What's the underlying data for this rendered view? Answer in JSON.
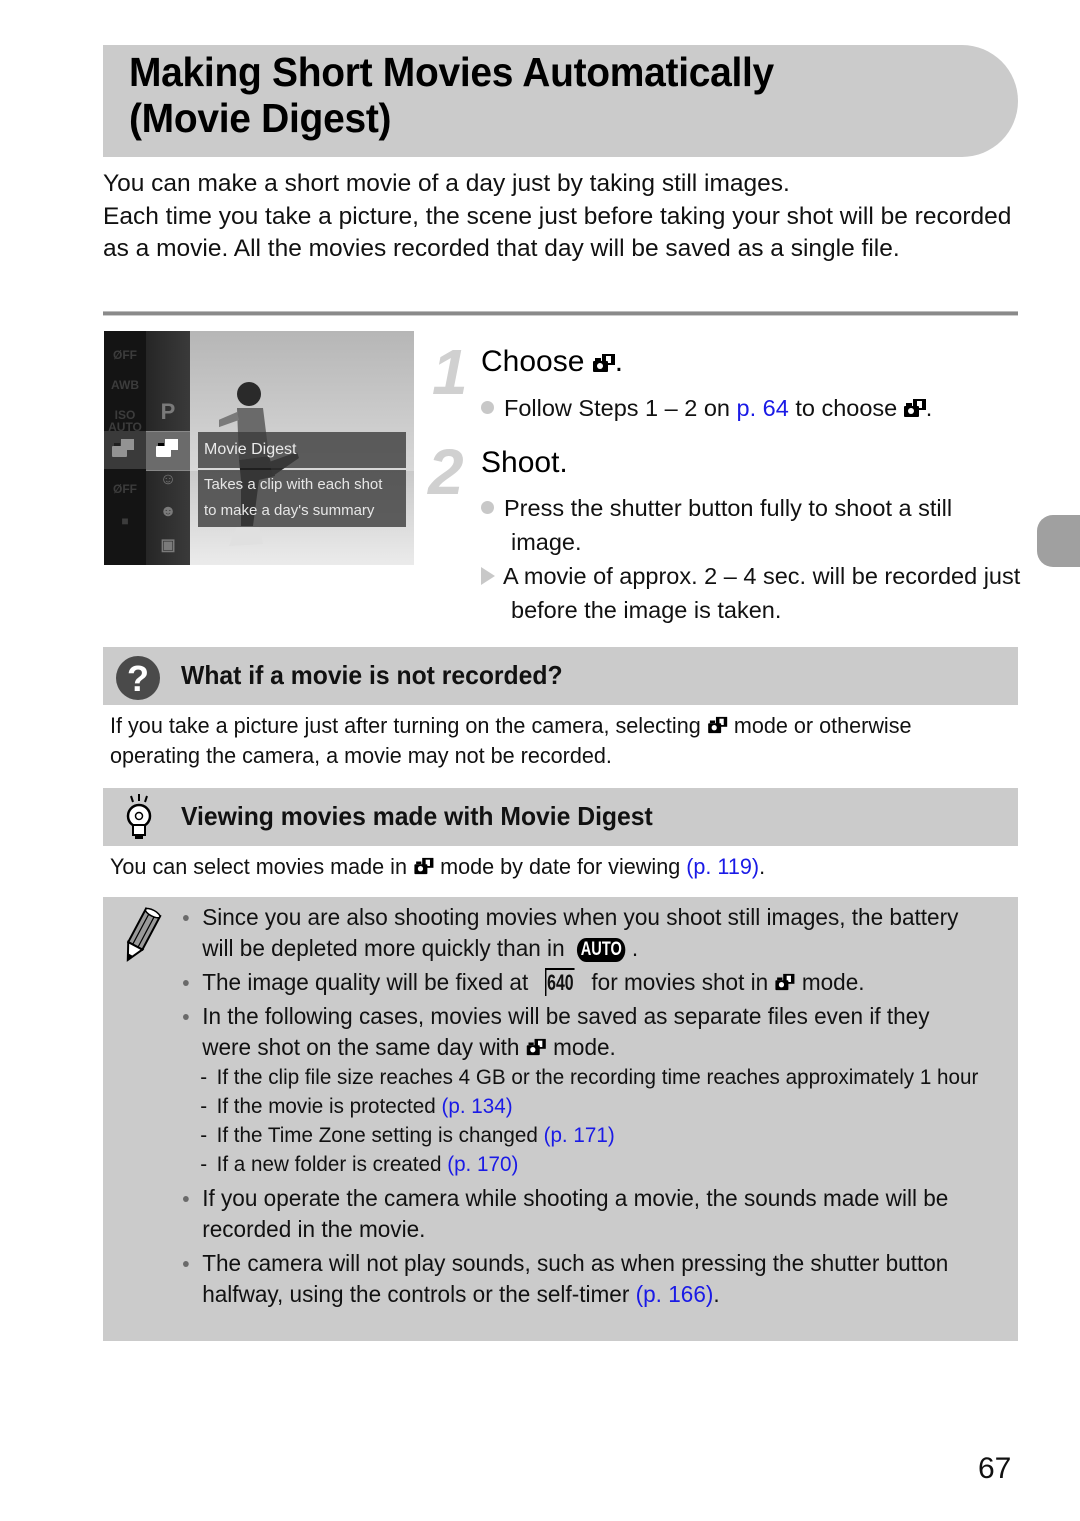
{
  "title": {
    "line1": "Making Short Movies Automatically",
    "line2": "(Movie Digest)"
  },
  "intro": {
    "p1": "You can make a short movie of a day just by taking still images.",
    "p2": "Each time you take a picture, the scene just before taking your shot will be recorded as a movie. All the movies recorded that day will be saved as a single file."
  },
  "camera_screen": {
    "left_column": [
      "ØFF",
      "AWB",
      "ISO AUTO",
      "mode",
      "ØFF",
      "■"
    ],
    "mode_column": [
      "P",
      "movie-digest",
      "portrait",
      "smart-shutter",
      "scene"
    ],
    "selected_label": "Movie Digest",
    "description_line1": "Takes a clip with each shot",
    "description_line2": "to make a day's summary"
  },
  "steps": [
    {
      "number": "1",
      "title": "Choose",
      "title_icon": "movie-digest-mode-icon",
      "title_suffix": ".",
      "bullets": [
        {
          "type": "circle",
          "text_before": "Follow Steps 1 – 2 on ",
          "link": "p. 64",
          "text_after": " to choose",
          "icon": "movie-digest-mode-icon",
          "end": "."
        }
      ]
    },
    {
      "number": "2",
      "title": "Shoot.",
      "bullets": [
        {
          "type": "circle",
          "text": "Press the shutter button fully to shoot a still image."
        },
        {
          "type": "triangle",
          "text": "A movie of approx. 2 – 4 sec. will be recorded just before the image is taken."
        }
      ]
    }
  ],
  "troubleshoot": {
    "icon": "question-icon",
    "heading": "What if a movie is not recorded?",
    "text_before": "If you take a picture just after turning on the camera, selecting ",
    "text_after": " mode or otherwise operating the camera, a movie may not be recorded."
  },
  "tip": {
    "icon": "lightbulb-icon",
    "heading": "Viewing movies made with Movie Digest",
    "text_before": "You can select movies made in ",
    "text_middle": " mode by date for viewing ",
    "link": "(p. 119)",
    "end": "."
  },
  "notes": {
    "icon": "pencil-icon",
    "items": [
      {
        "text": "Since you are also shooting movies when you shoot still images, the battery will be depleted more quickly than in ",
        "badge": "AUTO",
        "end": "."
      },
      {
        "text_before": "The image quality will be fixed at ",
        "quality": "640",
        "text_middle": " for movies shot in ",
        "text_after": " mode."
      },
      {
        "text_before": "In the following cases, movies will be saved as separate files even if they were shot on the same day with ",
        "text_after": " mode."
      },
      {
        "text": "If you operate the camera while shooting a movie, the sounds made will be recorded in the movie."
      },
      {
        "text": "The camera will not play sounds, such as when pressing the shutter button halfway, using the controls or the self-timer ",
        "link": "(p. 166)",
        "end": "."
      }
    ],
    "sub_items": [
      {
        "text": "If the clip file size reaches 4 GB or the recording time reaches approximately 1 hour"
      },
      {
        "text": "If the movie is protected ",
        "link": "(p. 134)"
      },
      {
        "text": "If the Time Zone setting is changed ",
        "link": "(p. 171)"
      },
      {
        "text": "If a new folder is created ",
        "link": "(p. 170)"
      }
    ]
  },
  "page_number": "67",
  "colors": {
    "band_gray": "#cbcbcb",
    "link_blue": "#1a1ae6",
    "side_tab": "#a0a0a0",
    "step_number": "#d0d0d0"
  }
}
